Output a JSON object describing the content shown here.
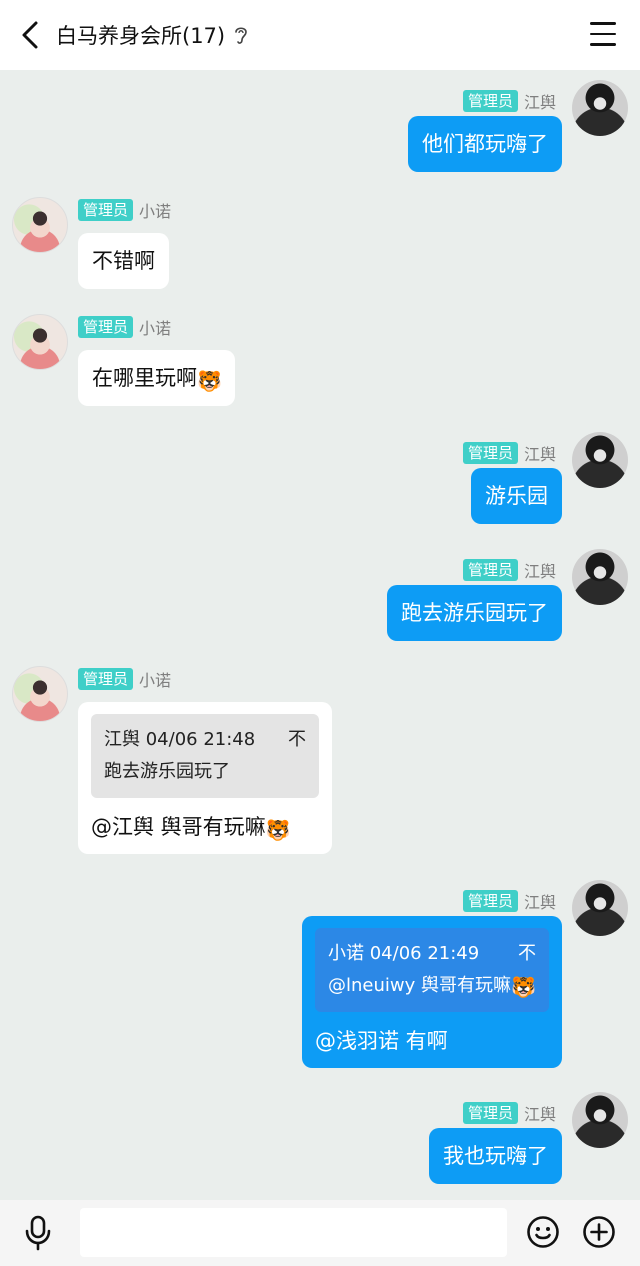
{
  "header": {
    "title": "白马养身会所(17)"
  },
  "messages": [
    {
      "side": "right",
      "badge": "管理员",
      "sender": "江舆",
      "text": "他们都玩嗨了"
    },
    {
      "side": "left",
      "badge": "管理员",
      "sender": "小诺",
      "text": "不错啊"
    },
    {
      "side": "left",
      "badge": "管理员",
      "sender": "小诺",
      "text": "在哪里玩啊",
      "emoji": "🐯"
    },
    {
      "side": "right",
      "badge": "管理员",
      "sender": "江舆",
      "text": "游乐园"
    },
    {
      "side": "right",
      "badge": "管理员",
      "sender": "江舆",
      "text": "跑去游乐园玩了"
    },
    {
      "side": "left",
      "badge": "管理员",
      "sender": "小诺",
      "quote": {
        "header": "江舆 04/06 21:48",
        "icon": "不",
        "text": "跑去游乐园玩了"
      },
      "text": "@江舆 舆哥有玩嘛",
      "emoji": "🐯"
    },
    {
      "side": "right",
      "badge": "管理员",
      "sender": "江舆",
      "quote": {
        "header": "小诺 04/06 21:49",
        "icon": "不",
        "text": "@lneuiwy 舆哥有玩嘛",
        "emoji": "🐯"
      },
      "text": "@浅羽诺 有啊"
    },
    {
      "side": "right",
      "badge": "管理员",
      "sender": "江舆",
      "text": "我也玩嗨了"
    }
  ],
  "composer": {
    "placeholder": ""
  },
  "icons": {
    "back": "back-arrow-icon",
    "ear": "ear-icon",
    "menu": "menu-icon",
    "mic": "microphone-icon",
    "emoji": "smiley-icon",
    "plus": "plus-icon"
  },
  "colors": {
    "badge": "#3fcfc8",
    "outgoing_bubble": "#0d9cf5",
    "background": "#eaeeec"
  }
}
